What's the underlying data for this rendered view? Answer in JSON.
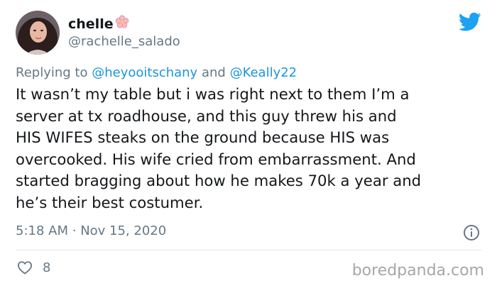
{
  "author": {
    "name": "chelle",
    "handle": "@rachelle_salado",
    "name_emoji": "cherry-blossom-icon"
  },
  "reply": {
    "prefix": "Replying to",
    "user1": "@heyooitschany",
    "conjunction": "and",
    "user2": "@Keally22"
  },
  "tweet": {
    "lines": [
      "It wasn’t my table but i was right next to them I’m a",
      "server at tx roadhouse, and this guy threw his and",
      "HIS WIFES steaks on the ground because HIS was",
      "overcooked. His wife cried from embarrassment. And",
      "started bragging about how he makes 70k a year and",
      "he’s their best costumer."
    ]
  },
  "meta": {
    "time": "5:18 AM",
    "separator": "·",
    "date": "Nov 15, 2020"
  },
  "stats": {
    "likes": "8"
  },
  "watermark": "boredpanda.com",
  "colors": {
    "twitter_blue": "#1da1f2",
    "link_blue": "#1b95e0",
    "secondary_text": "#657786",
    "primary_text": "#14171a"
  }
}
